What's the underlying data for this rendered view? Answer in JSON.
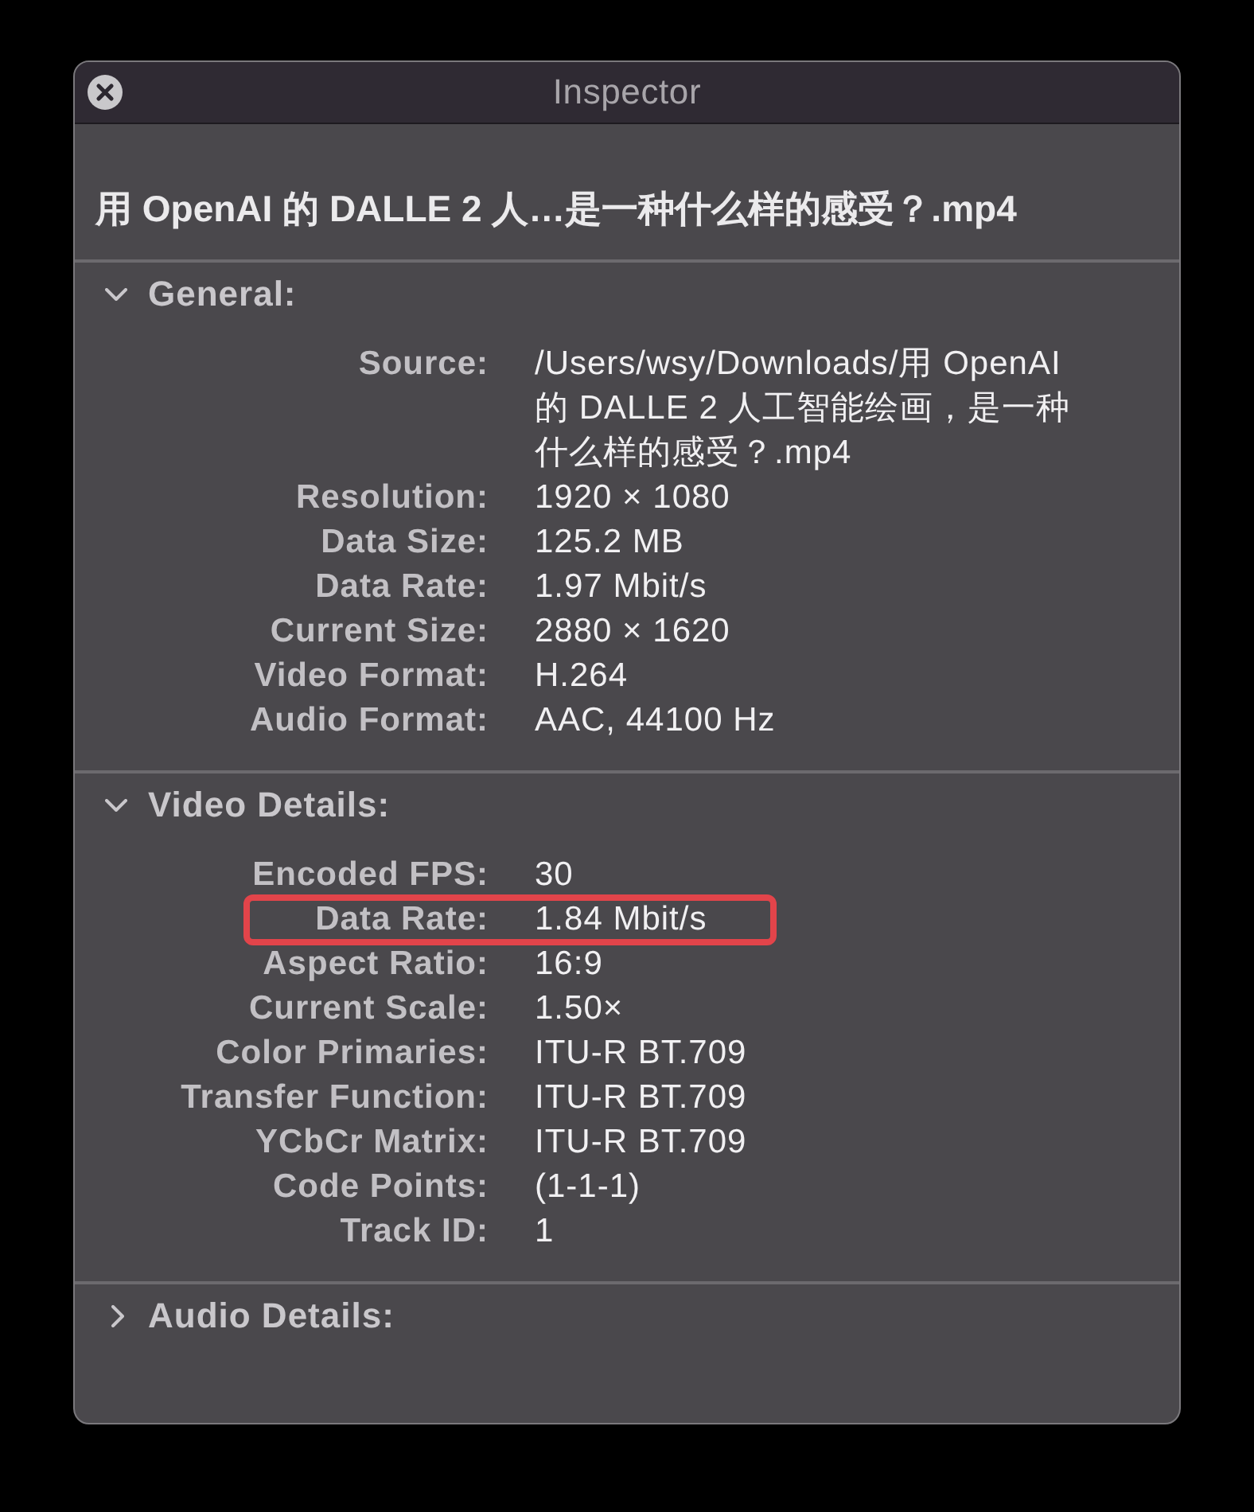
{
  "window": {
    "title": "Inspector",
    "file_name": "用 OpenAI 的 DALLE 2 人…是一种什么样的感受？.mp4"
  },
  "sections": [
    {
      "title": "General:",
      "expanded": true,
      "rows": [
        {
          "label": "Source:",
          "value": "/Users/wsy/Downloads/用 OpenAI 的 DALLE 2 人工智能绘画，是一种什么样的感受？.mp4",
          "highlighted": false
        },
        {
          "label": "Resolution:",
          "value": "1920 × 1080",
          "highlighted": false
        },
        {
          "label": "Data Size:",
          "value": "125.2 MB",
          "highlighted": false
        },
        {
          "label": "Data Rate:",
          "value": "1.97 Mbit/s",
          "highlighted": false
        },
        {
          "label": "Current Size:",
          "value": "2880 × 1620",
          "highlighted": false
        },
        {
          "label": "Video Format:",
          "value": "H.264",
          "highlighted": false
        },
        {
          "label": "Audio Format:",
          "value": "AAC, 44100 Hz",
          "highlighted": false
        }
      ]
    },
    {
      "title": "Video Details:",
      "expanded": true,
      "rows": [
        {
          "label": "Encoded FPS:",
          "value": "30",
          "highlighted": false
        },
        {
          "label": "Data Rate:",
          "value": "1.84 Mbit/s",
          "highlighted": true
        },
        {
          "label": "Aspect Ratio:",
          "value": "16:9",
          "highlighted": false
        },
        {
          "label": "Current Scale:",
          "value": "1.50×",
          "highlighted": false
        },
        {
          "label": "Color Primaries:",
          "value": "ITU-R BT.709",
          "highlighted": false
        },
        {
          "label": "Transfer Function:",
          "value": "ITU-R BT.709",
          "highlighted": false
        },
        {
          "label": "YCbCr Matrix:",
          "value": "ITU-R BT.709",
          "highlighted": false
        },
        {
          "label": "Code Points:",
          "value": "(1-1-1)",
          "highlighted": false
        },
        {
          "label": "Track ID:",
          "value": "1",
          "highlighted": false
        }
      ]
    },
    {
      "title": "Audio Details:",
      "expanded": false
    }
  ]
}
